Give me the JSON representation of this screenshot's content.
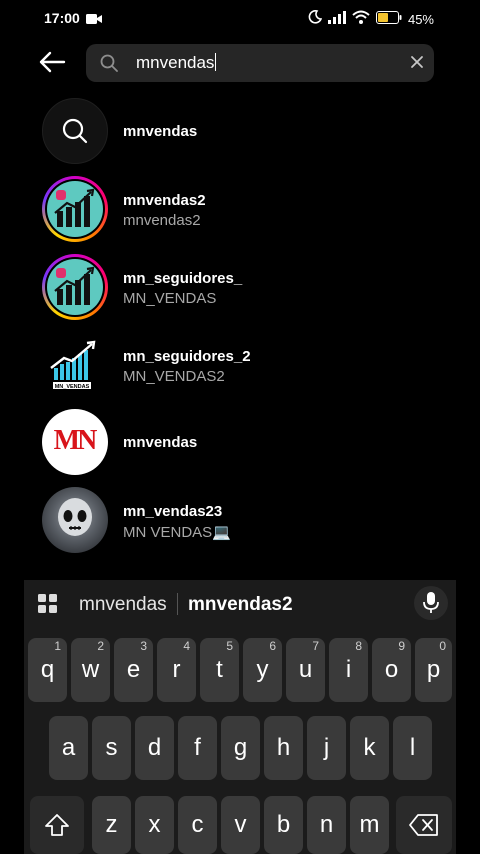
{
  "status": {
    "time": "17:00",
    "battery_pct": "45%"
  },
  "search": {
    "query": "mnvendas"
  },
  "results": [
    {
      "title": "mnvendas",
      "subtitle": ""
    },
    {
      "title": "mnvendas2",
      "subtitle": "mnvendas2"
    },
    {
      "title": "mn_seguidores_",
      "subtitle": "MN_VENDAS"
    },
    {
      "title": "mn_seguidores_2",
      "subtitle": "MN_VENDAS2"
    },
    {
      "title": "mnvendas",
      "subtitle": ""
    },
    {
      "title": "mn_vendas23",
      "subtitle": "MN VENDAS💻"
    }
  ],
  "avatar_texts": {
    "mn_logo": "MN",
    "chart_badge": "MN_VENDAS"
  },
  "keyboard": {
    "suggestions": [
      "mnvendas",
      "mnvendas2"
    ],
    "row1": [
      {
        "k": "q",
        "n": "1"
      },
      {
        "k": "w",
        "n": "2"
      },
      {
        "k": "e",
        "n": "3"
      },
      {
        "k": "r",
        "n": "4"
      },
      {
        "k": "t",
        "n": "5"
      },
      {
        "k": "y",
        "n": "6"
      },
      {
        "k": "u",
        "n": "7"
      },
      {
        "k": "i",
        "n": "8"
      },
      {
        "k": "o",
        "n": "9"
      },
      {
        "k": "p",
        "n": "0"
      }
    ],
    "row2": [
      "a",
      "s",
      "d",
      "f",
      "g",
      "h",
      "j",
      "k",
      "l"
    ],
    "row3": [
      "z",
      "x",
      "c",
      "v",
      "b",
      "n",
      "m"
    ]
  },
  "colors": {
    "accent_ring": "#d300c5",
    "background": "#000000",
    "keyboard": "#1b1b1b",
    "mn_red": "#d8141b"
  }
}
